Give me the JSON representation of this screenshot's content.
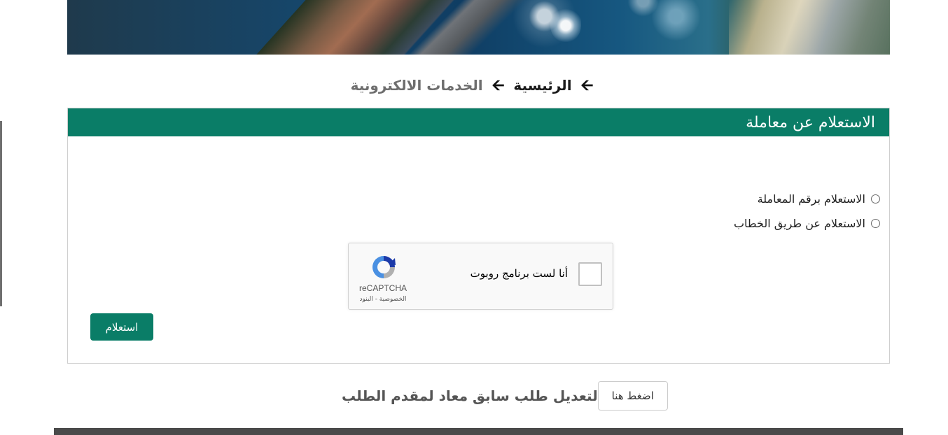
{
  "breadcrumb": {
    "home": "الرئيسية",
    "current": "الخدمات الالكترونية",
    "separator": "🡨"
  },
  "panel": {
    "title": "الاستعلام عن معاملة",
    "options": [
      {
        "label": "الاستعلام برقم المعاملة",
        "selected": false
      },
      {
        "label": "الاستعلام عن طريق الخطاب",
        "selected": false
      }
    ],
    "recaptcha": {
      "checkbox_label": "أنا لست برنامج روبوت",
      "brand": "reCAPTCHA",
      "links": "الخصوصية - البنود",
      "checked": false
    },
    "submit_label": "استعلام"
  },
  "edit_request": {
    "text": "لتعديل طلب سابق معاد لمقدم الطلب",
    "button_label": "اضغط هنا"
  },
  "colors": {
    "primary": "#0a7d67",
    "footer": "#4a4a4a"
  }
}
